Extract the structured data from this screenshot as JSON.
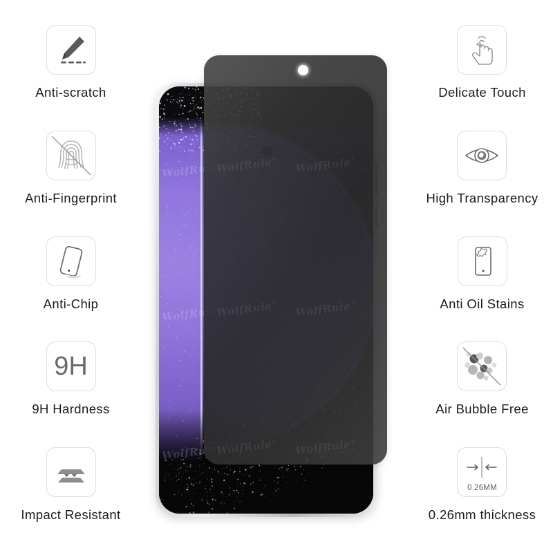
{
  "page": {
    "background_color": "#ffffff",
    "product": "privacy tempered glass screen protector infographic"
  },
  "left_features": [
    {
      "label": "Anti-scratch",
      "icon": "pencil-scratch-icon"
    },
    {
      "label": "Anti-Fingerprint",
      "icon": "fingerprint-slash-icon"
    },
    {
      "label": "Anti-Chip",
      "icon": "tilted-phone-icon"
    },
    {
      "label": "9H Hardness",
      "icon": "9h-text-icon",
      "icon_text": "9H"
    },
    {
      "label": "Impact Resistant",
      "icon": "layered-plates-icon"
    }
  ],
  "right_features": [
    {
      "label": "Delicate Touch",
      "icon": "tap-hand-icon"
    },
    {
      "label": "High Transparency",
      "icon": "eye-icon"
    },
    {
      "label": "Anti Oil Stains",
      "icon": "phone-stain-icon"
    },
    {
      "label": "Air Bubble Free",
      "icon": "bubbles-slash-icon"
    },
    {
      "label": "0.26mm thickness",
      "icon": "thickness-arrows-icon",
      "icon_text": "0.26MM"
    }
  ],
  "center": {
    "device_name": "smartphone",
    "film_name": "privacy-screen-protector",
    "watermark_text": "WolfRule",
    "watermark_mark": "®",
    "colors": {
      "film": "#2c2c2e",
      "wallpaper_purple": "#9b82e2",
      "wallpaper_dark": "#15101f",
      "frame_silver": "#cfcfd4",
      "screen_black": "#070708"
    }
  }
}
